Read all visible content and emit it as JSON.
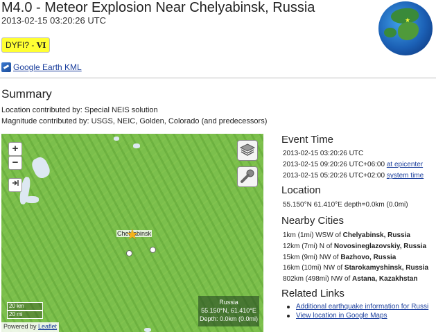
{
  "header": {
    "title": "M4.0 - Meteor Explosion Near Chelyabinsk, Russia",
    "datetime": "2013-02-15 03:20:26 UTC",
    "dyfi_label": "DYFI? -",
    "dyfi_value": "VI",
    "kml_link": "Google Earth KML"
  },
  "summary": {
    "heading": "Summary",
    "location_contrib": "Location contributed by: Special NEIS solution",
    "magnitude_contrib": "Magnitude contributed by: USGS, NEIC, Golden, Colorado (and predecessors)"
  },
  "map": {
    "zoom_in": "+",
    "zoom_out": "−",
    "epicenter_label": "Chelyabinsk",
    "scale_km": "20 km",
    "scale_mi": "20 mi",
    "attribution_prefix": "Powered by ",
    "attribution_link": "Leaflet",
    "info_country": "Russia",
    "info_coords": "55.150°N, 61.410°E",
    "info_depth": "Depth: 0.0km (0.0mi)"
  },
  "event_time": {
    "heading": "Event Time",
    "utc": "2013-02-15 03:20:26 UTC",
    "epicenter_time": "2013-02-15 09:20:26 UTC+06:00 ",
    "epicenter_link": "at epicenter",
    "system_time": "2013-02-15 05:20:26 UTC+02:00 ",
    "system_link": "system time"
  },
  "location": {
    "heading": "Location",
    "value": "55.150°N 61.410°E depth=0.0km (0.0mi)"
  },
  "nearby_cities": {
    "heading": "Nearby Cities",
    "items": [
      {
        "dist": "1km (1mi) WSW of ",
        "city": "Chelyabinsk, Russia"
      },
      {
        "dist": "12km (7mi) N of ",
        "city": "Novosineglazovskiy, Russia"
      },
      {
        "dist": "15km (9mi) NW of ",
        "city": "Bazhovo, Russia"
      },
      {
        "dist": "16km (10mi) NW of ",
        "city": "Starokamyshinsk, Russia"
      },
      {
        "dist": "802km (498mi) NW of ",
        "city": "Astana, Kazakhstan"
      }
    ]
  },
  "related_links": {
    "heading": "Related Links",
    "items": [
      "Additional earthquake information for Russi",
      "View location in Google Maps"
    ]
  },
  "colors": {
    "map_green": "#7bbf4c",
    "dyfi_yellow": "#ffff33",
    "link_blue": "#1a3e9c"
  }
}
